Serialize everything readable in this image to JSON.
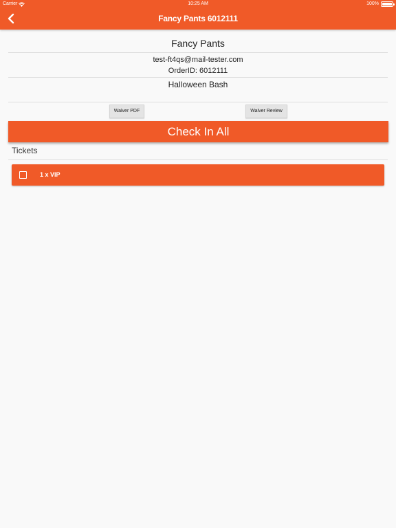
{
  "status_bar": {
    "carrier": "Carrier",
    "time": "10:25 AM",
    "battery": "100%"
  },
  "nav": {
    "title": "Fancy Pants 6012111"
  },
  "order": {
    "name": "Fancy Pants",
    "email": "test-ft4qs@mail-tester.com",
    "order_id": "OrderID: 6012111",
    "event": "Halloween Bash"
  },
  "waiver": {
    "pdf_label": "Waiver PDF",
    "review_label": "Waiver Review"
  },
  "check_in_all_label": "Check In All",
  "tickets": {
    "label": "Tickets",
    "items": [
      {
        "label": "1 x VIP",
        "checked": false
      }
    ]
  },
  "colors": {
    "accent": "#f05a28",
    "background": "#f9f9f9"
  }
}
